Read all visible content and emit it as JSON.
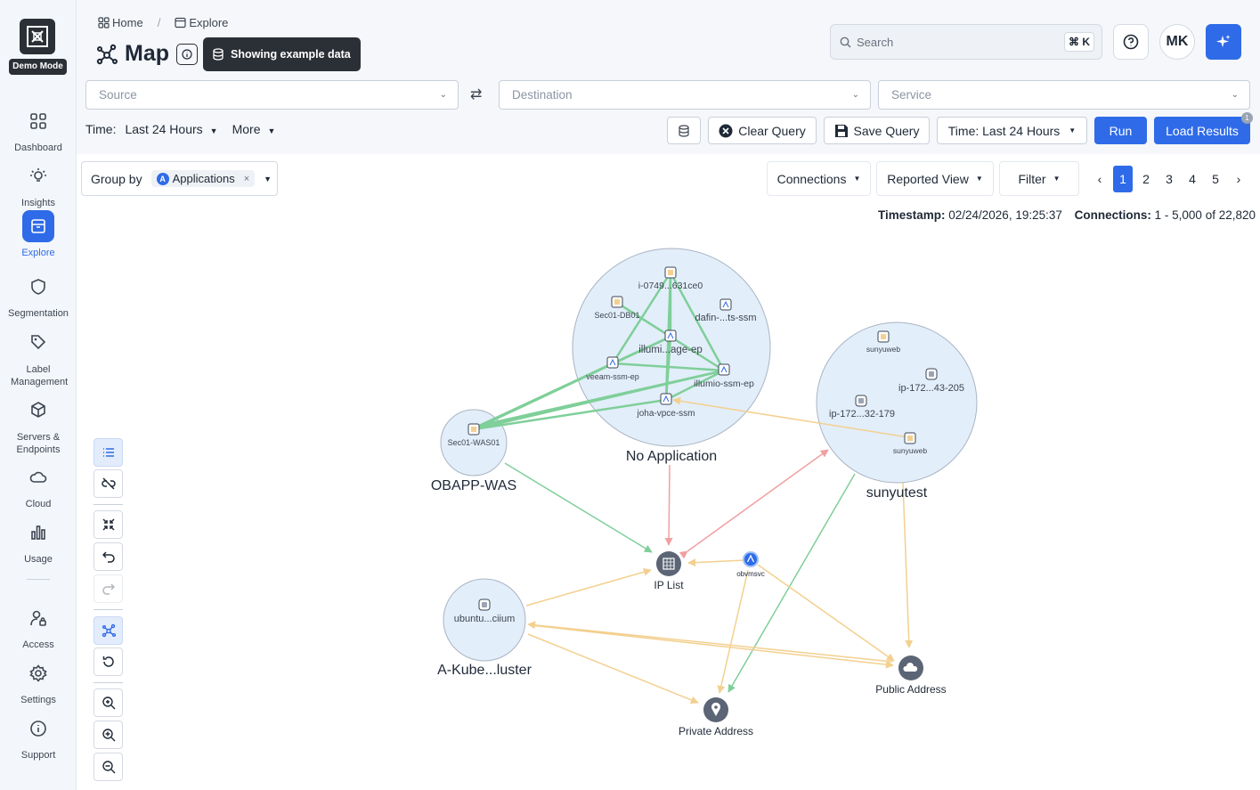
{
  "sidebar": {
    "demo_badge": "Demo Mode",
    "items": [
      {
        "label": "Dashboard"
      },
      {
        "label": "Insights"
      },
      {
        "label": "Explore"
      },
      {
        "label": "Segmentation"
      },
      {
        "label": "Label Management"
      },
      {
        "label": "Servers & Endpoints"
      },
      {
        "label": "Cloud"
      },
      {
        "label": "Usage"
      },
      {
        "label": "Access"
      },
      {
        "label": "Settings"
      },
      {
        "label": "Support"
      }
    ]
  },
  "breadcrumb": {
    "home": "Home",
    "current": "Explore"
  },
  "header": {
    "title": "Map",
    "example_badge": "Showing example data",
    "search_placeholder": "Search",
    "search_shortcut": "⌘ K",
    "avatar_initials": "MK"
  },
  "query": {
    "source_placeholder": "Source",
    "destination_placeholder": "Destination",
    "service_placeholder": "Service",
    "time_label": "Time:",
    "time_value": "Last 24 Hours",
    "more_label": "More",
    "clear_label": "Clear Query",
    "save_label": "Save Query",
    "time_button": "Time: Last 24 Hours",
    "run_label": "Run",
    "load_label": "Load Results",
    "load_badge": "1"
  },
  "controls": {
    "group_by_label": "Group by",
    "group_by_chip": "Applications",
    "chip_remove": "×",
    "connections_label": "Connections",
    "reported_view_label": "Reported View",
    "filter_label": "Filter",
    "pages": [
      "1",
      "2",
      "3",
      "4",
      "5"
    ],
    "prev": "‹",
    "next": "›"
  },
  "stats": {
    "timestamp_label": "Timestamp:",
    "timestamp_value": "02/24/2026, 19:25:37",
    "connections_label": "Connections:",
    "connections_value": "1 - 5,000 of 22,820"
  },
  "map": {
    "groups": [
      {
        "name": "No Application"
      },
      {
        "name": "OBAPP-WAS"
      },
      {
        "name": "sunyutest"
      },
      {
        "name": "A-Kube...luster"
      }
    ],
    "workloads": [
      {
        "name": "i-0749...631ce0"
      },
      {
        "name": "Sec01-DB01"
      },
      {
        "name": "dafin-...ts-ssm"
      },
      {
        "name": "illumi...age-ep"
      },
      {
        "name": "veeam-ssm-ep"
      },
      {
        "name": "illumio-ssm-ep"
      },
      {
        "name": "joha-vpce-ssm"
      },
      {
        "name": "Sec01-WAS01"
      },
      {
        "name": "sunyuweb"
      },
      {
        "name": "ip-172...43-205"
      },
      {
        "name": "ip-172...32-179"
      },
      {
        "name": "sunyuweb"
      },
      {
        "name": "ubuntu...ciium"
      }
    ],
    "endpoints": [
      {
        "name": "IP List"
      },
      {
        "name": "obvmsvc"
      },
      {
        "name": "Public Address"
      },
      {
        "name": "Private Address"
      }
    ],
    "colors": {
      "allowed": "#7fcf99",
      "blocked": "#f0a0a0",
      "potential": "#f3d08f",
      "group_fill": "#e2eefa"
    }
  }
}
